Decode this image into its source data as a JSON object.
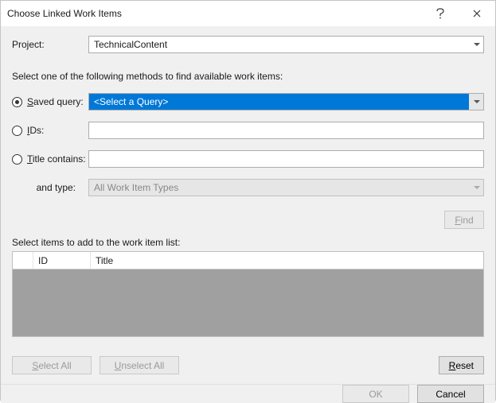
{
  "title": "Choose Linked Work Items",
  "project_label": "Project:",
  "project_value": "TechnicalContent",
  "instructions": "Select one of the following methods to find available work items:",
  "methods": {
    "saved_query": {
      "label_pre": "S",
      "label_rest": "aved query:",
      "selected": true,
      "dropdown_value": "<Select a Query>"
    },
    "ids": {
      "label_pre": "I",
      "label_rest": "Ds:",
      "selected": false,
      "value": ""
    },
    "title_contains": {
      "label_pre": "T",
      "label_rest": "itle contains:",
      "selected": false,
      "value": ""
    },
    "and_type": {
      "label": "and type:",
      "dropdown_value": "All Work Item Types"
    }
  },
  "find_label_pre": "F",
  "find_label_rest": "ind",
  "list_label": "Select items to add to the work item list:",
  "columns": {
    "id": "ID",
    "title": "Title"
  },
  "buttons": {
    "select_all_pre": "S",
    "select_all_rest": "elect All",
    "unselect_all_pre": "U",
    "unselect_all_rest": "nselect All",
    "reset_pre": "R",
    "reset_rest": "eset",
    "ok": "OK",
    "cancel": "Cancel"
  }
}
